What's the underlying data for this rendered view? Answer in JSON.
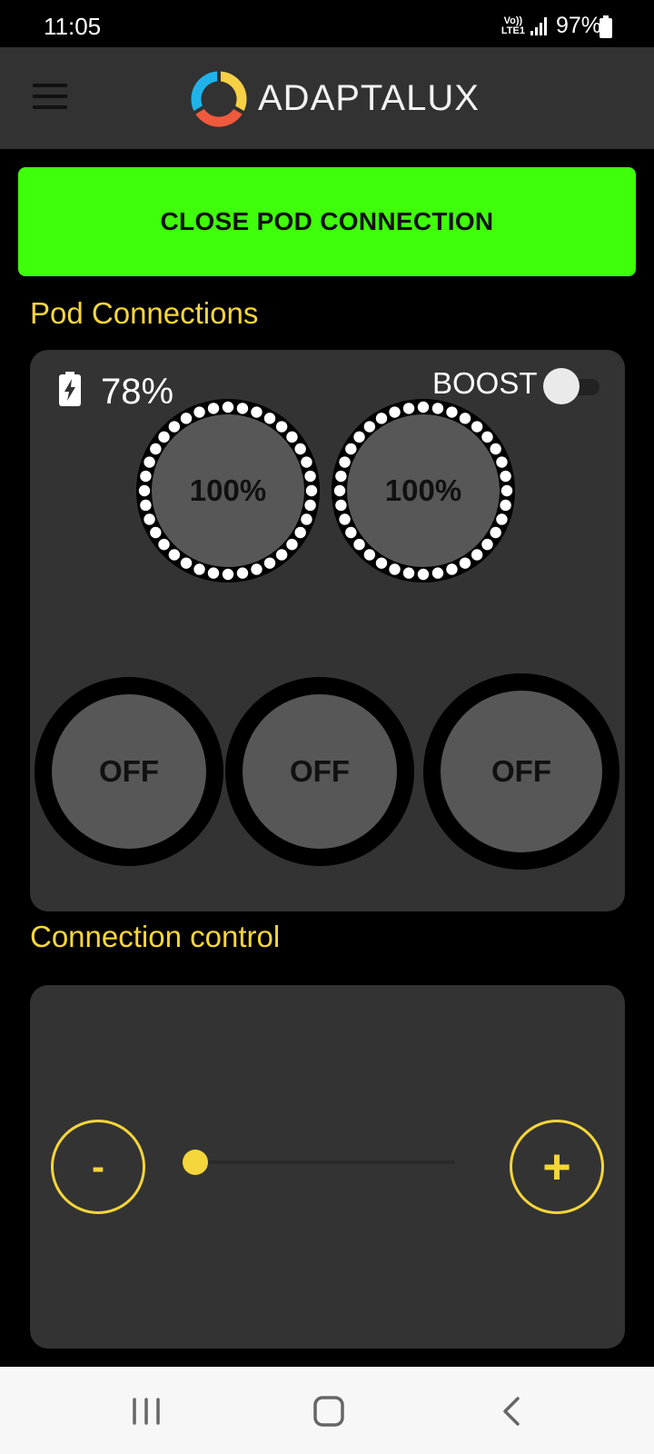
{
  "status_bar": {
    "time": "11:05",
    "network_top": "Vo))",
    "network_bottom": "LTE1",
    "battery_percent": "97%"
  },
  "app_bar": {
    "brand": "ADAPTALUX",
    "logo_colors": [
      "#1fb3ea",
      "#f7d046",
      "#ef5a3c"
    ]
  },
  "actions": {
    "close_connection_label": "CLOSE POD CONNECTION"
  },
  "pod_connections": {
    "title": "Pod Connections",
    "battery": "78%",
    "boost_label": "BOOST",
    "boost_on": false,
    "dials": [
      {
        "label": "100%"
      },
      {
        "label": "100%"
      }
    ],
    "switches": [
      {
        "label": "OFF"
      },
      {
        "label": "OFF"
      },
      {
        "label": "OFF"
      }
    ]
  },
  "connection_control": {
    "title": "Connection control",
    "minus_label": "-",
    "plus_label": "+",
    "slider_value": 0
  },
  "colors": {
    "accent_yellow": "#f5d63a",
    "close_button_green": "#3fff0a",
    "card_bg": "#333333"
  }
}
